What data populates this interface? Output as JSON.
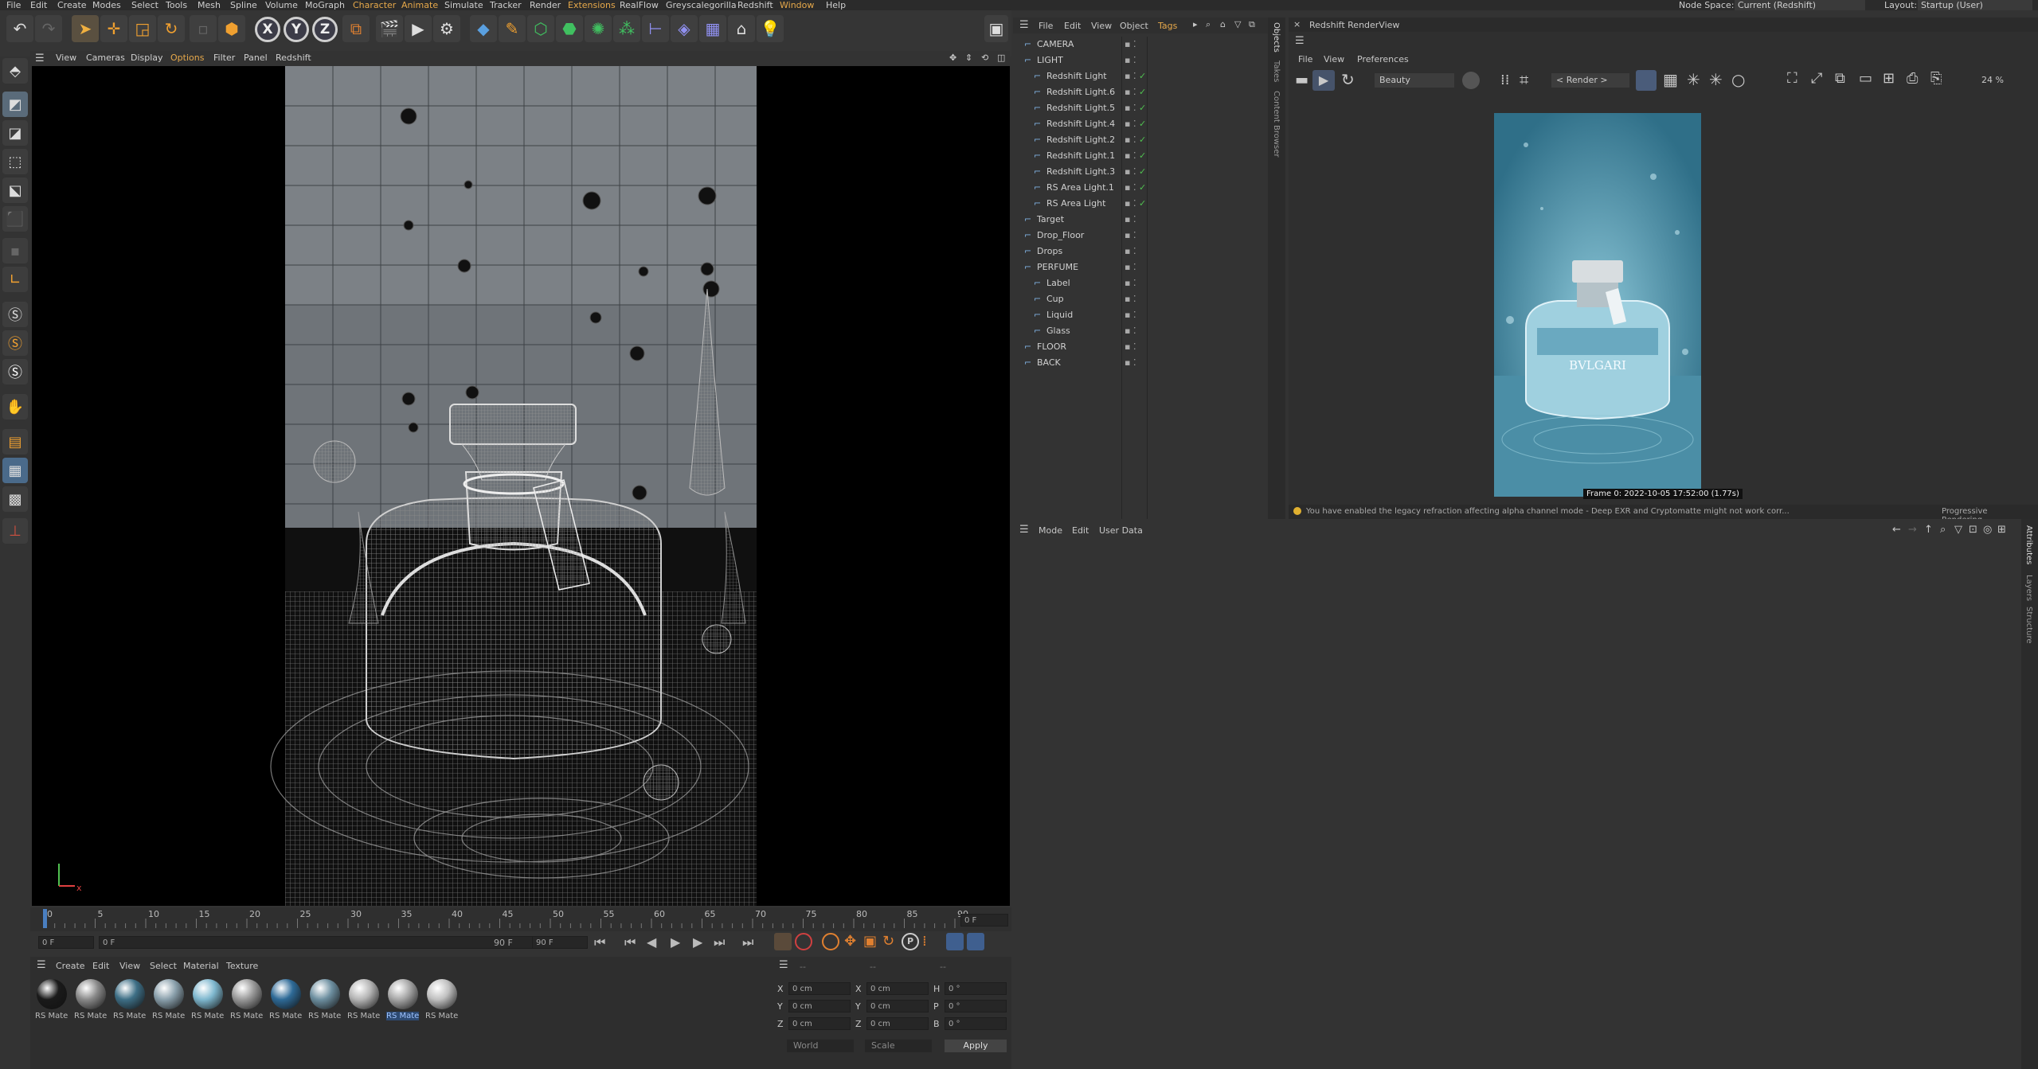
{
  "menu": {
    "items": [
      "File",
      "Edit",
      "Create",
      "Modes",
      "Select",
      "Tools",
      "Mesh",
      "Spline",
      "Volume",
      "MoGraph",
      "Character",
      "Animate",
      "Simulate",
      "Tracker",
      "Render",
      "Extensions",
      "RealFlow",
      "Greyscalegorilla",
      "Redshift",
      "Window",
      "Help"
    ],
    "node_space_label": "Node Space:",
    "node_space_value": "Current (Redshift)",
    "layout_label": "Layout:",
    "layout_value": "Startup (User)"
  },
  "viewport": {
    "menu": [
      "View",
      "Cameras",
      "Display",
      "Options",
      "Filter",
      "Panel",
      "Redshift"
    ]
  },
  "timeline": {
    "ticks": [
      "0",
      "5",
      "10",
      "15",
      "20",
      "25",
      "30",
      "35",
      "40",
      "45",
      "50",
      "55",
      "60",
      "65",
      "70",
      "75",
      "80",
      "85",
      "90"
    ],
    "current_frame": "0 F",
    "start": "0 F",
    "start2": "0 F",
    "end": "90 F",
    "end2": "90 F"
  },
  "materials": {
    "menu": [
      "Create",
      "Edit",
      "View",
      "Select",
      "Material",
      "Texture"
    ],
    "items": [
      {
        "label": "RS Mate",
        "color": "#1a1a1a"
      },
      {
        "label": "RS Mate",
        "color": "#8a8a8a"
      },
      {
        "label": "RS Mate",
        "color": "#3e6f86"
      },
      {
        "label": "RS Mate",
        "color": "#8aa0ac"
      },
      {
        "label": "RS Mate",
        "color": "#7fb8cf"
      },
      {
        "label": "RS Mate",
        "color": "#9a9a9a"
      },
      {
        "label": "RS Mate",
        "color": "#2e6a97"
      },
      {
        "label": "RS Mate",
        "color": "#6d8fa0"
      },
      {
        "label": "RS Mate",
        "color": "#b5b5b5"
      },
      {
        "label": "RS Mate",
        "color": "#a7a7a7"
      },
      {
        "label": "RS Mate",
        "color": "#c0c0c0"
      }
    ]
  },
  "coords": {
    "headers": [
      "--",
      "--",
      "--"
    ],
    "rows": [
      {
        "a": "X",
        "av": "0 cm",
        "b": "X",
        "bv": "0 cm",
        "c": "H",
        "cv": "0 °"
      },
      {
        "a": "Y",
        "av": "0 cm",
        "b": "Y",
        "bv": "0 cm",
        "c": "P",
        "cv": "0 °"
      },
      {
        "a": "Z",
        "av": "0 cm",
        "b": "Z",
        "bv": "0 cm",
        "c": "B",
        "cv": "0 °"
      }
    ],
    "world": "World",
    "scale": "Scale",
    "apply": "Apply"
  },
  "objects": {
    "menu": [
      "File",
      "Edit",
      "View",
      "Object",
      "Tags"
    ],
    "rows": [
      {
        "name": "CAMERA",
        "indent": 0
      },
      {
        "name": "LIGHT",
        "indent": 0
      },
      {
        "name": "Redshift Light",
        "indent": 1
      },
      {
        "name": "Redshift Light.6",
        "indent": 1
      },
      {
        "name": "Redshift Light.5",
        "indent": 1
      },
      {
        "name": "Redshift Light.4",
        "indent": 1
      },
      {
        "name": "Redshift Light.2",
        "indent": 1
      },
      {
        "name": "Redshift Light.1",
        "indent": 1
      },
      {
        "name": "Redshift Light.3",
        "indent": 1
      },
      {
        "name": "RS Area Light.1",
        "indent": 1
      },
      {
        "name": "RS Area Light",
        "indent": 1
      },
      {
        "name": "Target",
        "indent": 0
      },
      {
        "name": "Drop_Floor",
        "indent": 0
      },
      {
        "name": "Drops",
        "indent": 0
      },
      {
        "name": "PERFUME",
        "indent": 0
      },
      {
        "name": "Label",
        "indent": 1
      },
      {
        "name": "Cup",
        "indent": 1
      },
      {
        "name": "Liquid",
        "indent": 1
      },
      {
        "name": "Glass",
        "indent": 1
      },
      {
        "name": "FLOOR",
        "indent": 0
      },
      {
        "name": "BACK",
        "indent": 0
      }
    ],
    "side_tabs": [
      "Objects",
      "Takes",
      "Content Browser"
    ]
  },
  "renderview": {
    "title": "Redshift RenderView",
    "menu": [
      "File",
      "View",
      "Preferences"
    ],
    "aov": "Beauty",
    "render_select": "< Render >",
    "zoom": "24 %",
    "frame_info": "Frame 0:  2022-10-05  17:52:00  (1.77s)",
    "bottle_label": "BVLGARI",
    "status": "You have enabled the legacy refraction affecting alpha channel mode - Deep EXR and Cryptomatte might not work corr...",
    "progress": "Progressive Rendering..."
  },
  "attributes": {
    "menu": [
      "Mode",
      "Edit",
      "User Data"
    ],
    "side_tabs": [
      "Attributes",
      "Layers",
      "Structure"
    ]
  }
}
